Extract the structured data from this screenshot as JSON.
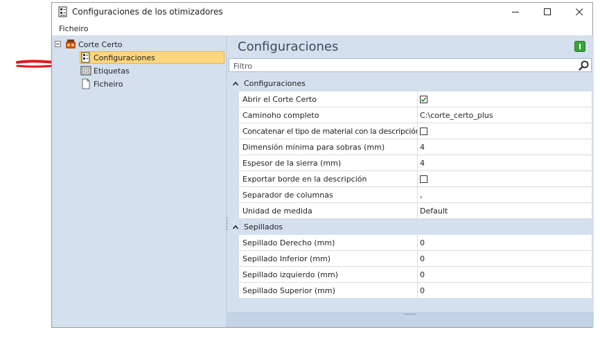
{
  "window": {
    "title": "Configuraciones de los otimizadores",
    "controls": {
      "minimize": "minimize-icon",
      "maximize": "maximize-icon",
      "close": "close-icon"
    }
  },
  "menu": {
    "items": [
      {
        "label": "Ficheiro"
      }
    ]
  },
  "tree": {
    "root": {
      "label": "Corte Certo",
      "expanded": true
    },
    "children": [
      {
        "label": "Configuraciones",
        "selected": true,
        "icon": "settings-doc-icon"
      },
      {
        "label": "Etiquetas",
        "selected": false,
        "icon": "labels-icon"
      },
      {
        "label": "Ficheiro",
        "selected": false,
        "icon": "file-icon"
      }
    ]
  },
  "panel": {
    "title": "Configuraciones",
    "filter_placeholder": "Filtro",
    "categories": [
      {
        "label": "Configuraciones",
        "expanded": true,
        "properties": [
          {
            "name": "Abrir el Corte Certo",
            "type": "checkbox",
            "checked": true
          },
          {
            "name": "Caminoho completo",
            "type": "text",
            "value": "C:\\corte_certo_plus"
          },
          {
            "name": "Concatenar el tipo de material con la descripción",
            "type": "checkbox",
            "checked": false
          },
          {
            "name": "Dimensión mínima para sobras (mm)",
            "type": "text",
            "value": "4"
          },
          {
            "name": "Espesor de la sierra (mm)",
            "type": "text",
            "value": "4"
          },
          {
            "name": "Exportar borde en la descripción",
            "type": "checkbox",
            "checked": false
          },
          {
            "name": "Separador de columnas",
            "type": "text",
            "value": ","
          },
          {
            "name": "Unidad de medida",
            "type": "text",
            "value": "Default"
          }
        ]
      },
      {
        "label": "Sepillados",
        "expanded": true,
        "properties": [
          {
            "name": "Sepillado Derecho (mm)",
            "type": "text",
            "value": "0"
          },
          {
            "name": "Sepillado Inferior (mm)",
            "type": "text",
            "value": "0"
          },
          {
            "name": "Sepillado izquierdo (mm)",
            "type": "text",
            "value": "0"
          },
          {
            "name": "Sepillado Superior (mm)",
            "type": "text",
            "value": "0"
          }
        ]
      }
    ]
  },
  "colors": {
    "pane_bg": "#d5e0ef",
    "selection": "#fdd77d",
    "arrow": "#e8131a",
    "check": "#2a8a2a",
    "green_button": "#3aa23a"
  }
}
